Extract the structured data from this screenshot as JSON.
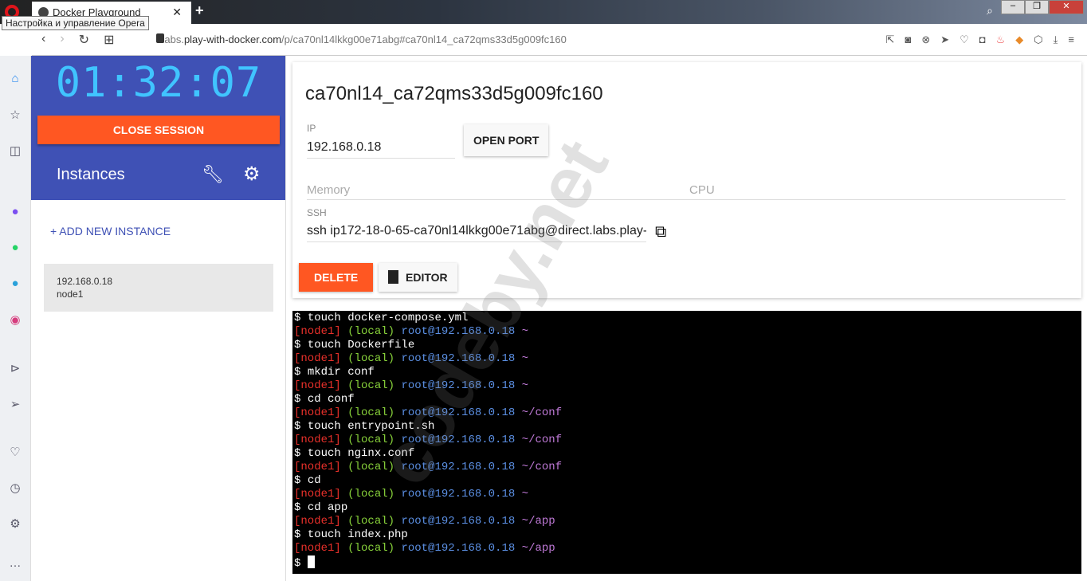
{
  "browser": {
    "tab_title": "Docker Playground",
    "tooltip": "Настройка и управление Opera",
    "url_prefix": "labs.",
    "url_host": "play-with-docker.com",
    "url_path": "/p/ca70nl14lkkg00e71abg#ca70nl14_ca72qms33d5g009fc160"
  },
  "session": {
    "timer": "01:32:07",
    "close_label": "CLOSE SESSION",
    "instances_label": "Instances",
    "add_label": "+ ADD NEW INSTANCE"
  },
  "instances": [
    {
      "ip": "192.168.0.18",
      "name": "node1"
    }
  ],
  "detail": {
    "title": "ca70nl14_ca72qms33d5g009fc160",
    "ip_label": "IP",
    "ip": "192.168.0.18",
    "open_port": "OPEN PORT",
    "memory_label": "Memory",
    "cpu_label": "CPU",
    "ssh_label": "SSH",
    "ssh": "ssh ip172-18-0-65-ca70nl14lkkg00e71abg@direct.labs.play-",
    "delete_label": "DELETE",
    "editor_label": "EDITOR"
  },
  "terminal": {
    "lines": [
      {
        "cmd": "touch docker-compose.yml",
        "path": "~"
      },
      {
        "cmd": "touch Dockerfile",
        "path": "~"
      },
      {
        "cmd": "mkdir conf",
        "path": "~"
      },
      {
        "cmd": "cd conf",
        "path": "~/conf"
      },
      {
        "cmd": "touch entrypoint.sh",
        "path": "~/conf"
      },
      {
        "cmd": "touch nginx.conf",
        "path": "~/conf"
      },
      {
        "cmd": "cd",
        "path": "~"
      },
      {
        "cmd": "cd app",
        "path": "~/app"
      },
      {
        "cmd": "touch index.php",
        "path": "~/app"
      }
    ],
    "node": "[node1]",
    "local": "(local)",
    "user": "root@192.168.0.18",
    "prompt": "$"
  },
  "watermark": "codeby.net"
}
